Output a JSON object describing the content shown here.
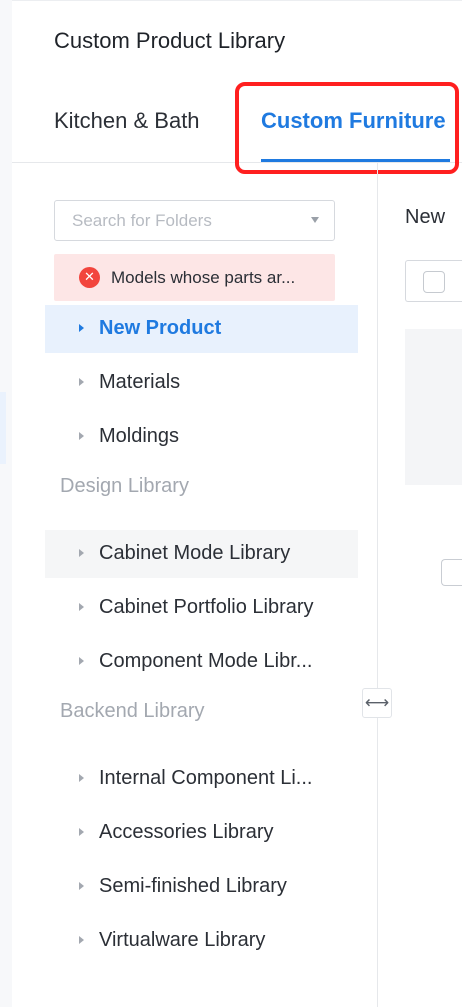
{
  "header": {
    "title": "Custom Product Library"
  },
  "tabs": [
    {
      "label": "Kitchen & Bath",
      "active": false
    },
    {
      "label": "Custom Furniture",
      "active": true
    }
  ],
  "search": {
    "placeholder": "Search for Folders",
    "value": ""
  },
  "error": {
    "icon": "error-circle-icon",
    "text": "Models whose parts ar..."
  },
  "tree": {
    "top_items": [
      {
        "label": "New Product",
        "selected": true
      },
      {
        "label": "Materials",
        "selected": false
      },
      {
        "label": "Moldings",
        "selected": false
      }
    ],
    "design_group": {
      "label": "Design Library",
      "items": [
        {
          "label": "Cabinet Mode Library"
        },
        {
          "label": "Cabinet Portfolio Library"
        },
        {
          "label": "Component Mode Libr..."
        }
      ]
    },
    "backend_group": {
      "label": "Backend Library",
      "items": [
        {
          "label": "Internal Component Li..."
        },
        {
          "label": "Accessories Library"
        },
        {
          "label": "Semi-finished Library"
        },
        {
          "label": "Virtualware Library"
        }
      ]
    }
  },
  "resize_handle": {
    "icon": "horizontal-resize-icon",
    "glyph": "⟷"
  },
  "right_panel": {
    "label": "New"
  },
  "colors": {
    "accent": "#1f7ae0",
    "error_bg": "#fde6e6",
    "error_icon": "#f2453d",
    "highlight": "#ff1f1f"
  }
}
